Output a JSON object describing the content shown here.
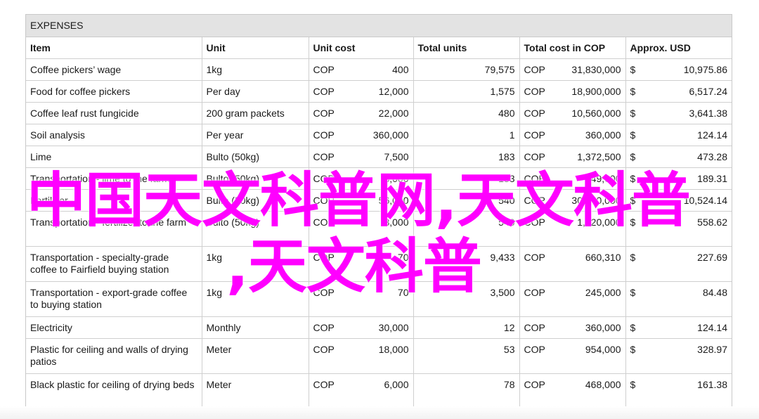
{
  "table_title": "EXPENSES",
  "headers": [
    "Item",
    "Unit",
    "Unit cost",
    "Total units",
    "Total cost in COP",
    "Approx. USD"
  ],
  "rows": [
    {
      "item": "Coffee pickers’ wage",
      "unit": "1kg",
      "cost_cur": "COP",
      "cost": "400",
      "units": "79,575",
      "total_cur": "COP",
      "total": "31,830,000",
      "usd_cur": "$",
      "usd": "10,975.86"
    },
    {
      "item": "Food for coffee pickers",
      "unit": "Per day",
      "cost_cur": "COP",
      "cost": "12,000",
      "units": "1,575",
      "total_cur": "COP",
      "total": "18,900,000",
      "usd_cur": "$",
      "usd": "6,517.24"
    },
    {
      "item": "Coffee leaf rust fungicide",
      "unit": "200 gram packets",
      "cost_cur": "COP",
      "cost": "22,000",
      "units": "480",
      "total_cur": "COP",
      "total": "10,560,000",
      "usd_cur": "$",
      "usd": "3,641.38"
    },
    {
      "item": "Soil analysis",
      "unit": "Per year",
      "cost_cur": "COP",
      "cost": "360,000",
      "units": "1",
      "total_cur": "COP",
      "total": "360,000",
      "usd_cur": "$",
      "usd": "124.14"
    },
    {
      "item": "Lime",
      "unit": "Bulto (50kg)",
      "cost_cur": "COP",
      "cost": "7,500",
      "units": "183",
      "total_cur": "COP",
      "total": "1,372,500",
      "usd_cur": "$",
      "usd": "473.28"
    },
    {
      "item": "Transportation - lime to the farm",
      "unit": "Bulto (50kg)",
      "cost_cur": "COP",
      "cost": "3,000",
      "units": "183",
      "total_cur": "COP",
      "total": "549,000",
      "usd_cur": "$",
      "usd": "189.31"
    },
    {
      "item": "Fertilizer",
      "unit": "Bulto (50kg)",
      "cost_cur": "COP",
      "cost": "56,000",
      "units": "540",
      "total_cur": "COP",
      "total": "30,240,000",
      "usd_cur": "$",
      "usd": "10,524.14"
    },
    {
      "item": "Transportation - fertilizer to the farm",
      "unit": "Bulto (50kg)",
      "cost_cur": "COP",
      "cost": "3,000",
      "units": "540",
      "total_cur": "COP",
      "total": "1,620,000",
      "usd_cur": "$",
      "usd": "558.62"
    },
    {
      "item": "Transportation - specialty-grade coffee to Fairfield buying station",
      "unit": "1kg",
      "cost_cur": "COP",
      "cost": "70",
      "units": "9,433",
      "total_cur": "COP",
      "total": "660,310",
      "usd_cur": "$",
      "usd": "227.69"
    },
    {
      "item": "Transportation - export-grade coffee to buying station",
      "unit": "1kg",
      "cost_cur": "COP",
      "cost": "70",
      "units": "3,500",
      "total_cur": "COP",
      "total": "245,000",
      "usd_cur": "$",
      "usd": "84.48"
    },
    {
      "item": "Electricity",
      "unit": "Monthly",
      "cost_cur": "COP",
      "cost": "30,000",
      "units": "12",
      "total_cur": "COP",
      "total": "360,000",
      "usd_cur": "$",
      "usd": "124.14"
    },
    {
      "item": "Plastic for ceiling and walls of drying patios",
      "unit": "Meter",
      "cost_cur": "COP",
      "cost": "18,000",
      "units": "53",
      "total_cur": "COP",
      "total": "954,000",
      "usd_cur": "$",
      "usd": "328.97"
    },
    {
      "item": "Black plastic for ceiling of drying beds",
      "unit": "Meter",
      "cost_cur": "COP",
      "cost": "6,000",
      "units": "78",
      "total_cur": "COP",
      "total": "468,000",
      "usd_cur": "$",
      "usd": "161.38"
    }
  ],
  "watermark": {
    "line1": "中国天文科普网,天文科普",
    "line2": ",天文科普",
    "color": "#ff00ff"
  }
}
